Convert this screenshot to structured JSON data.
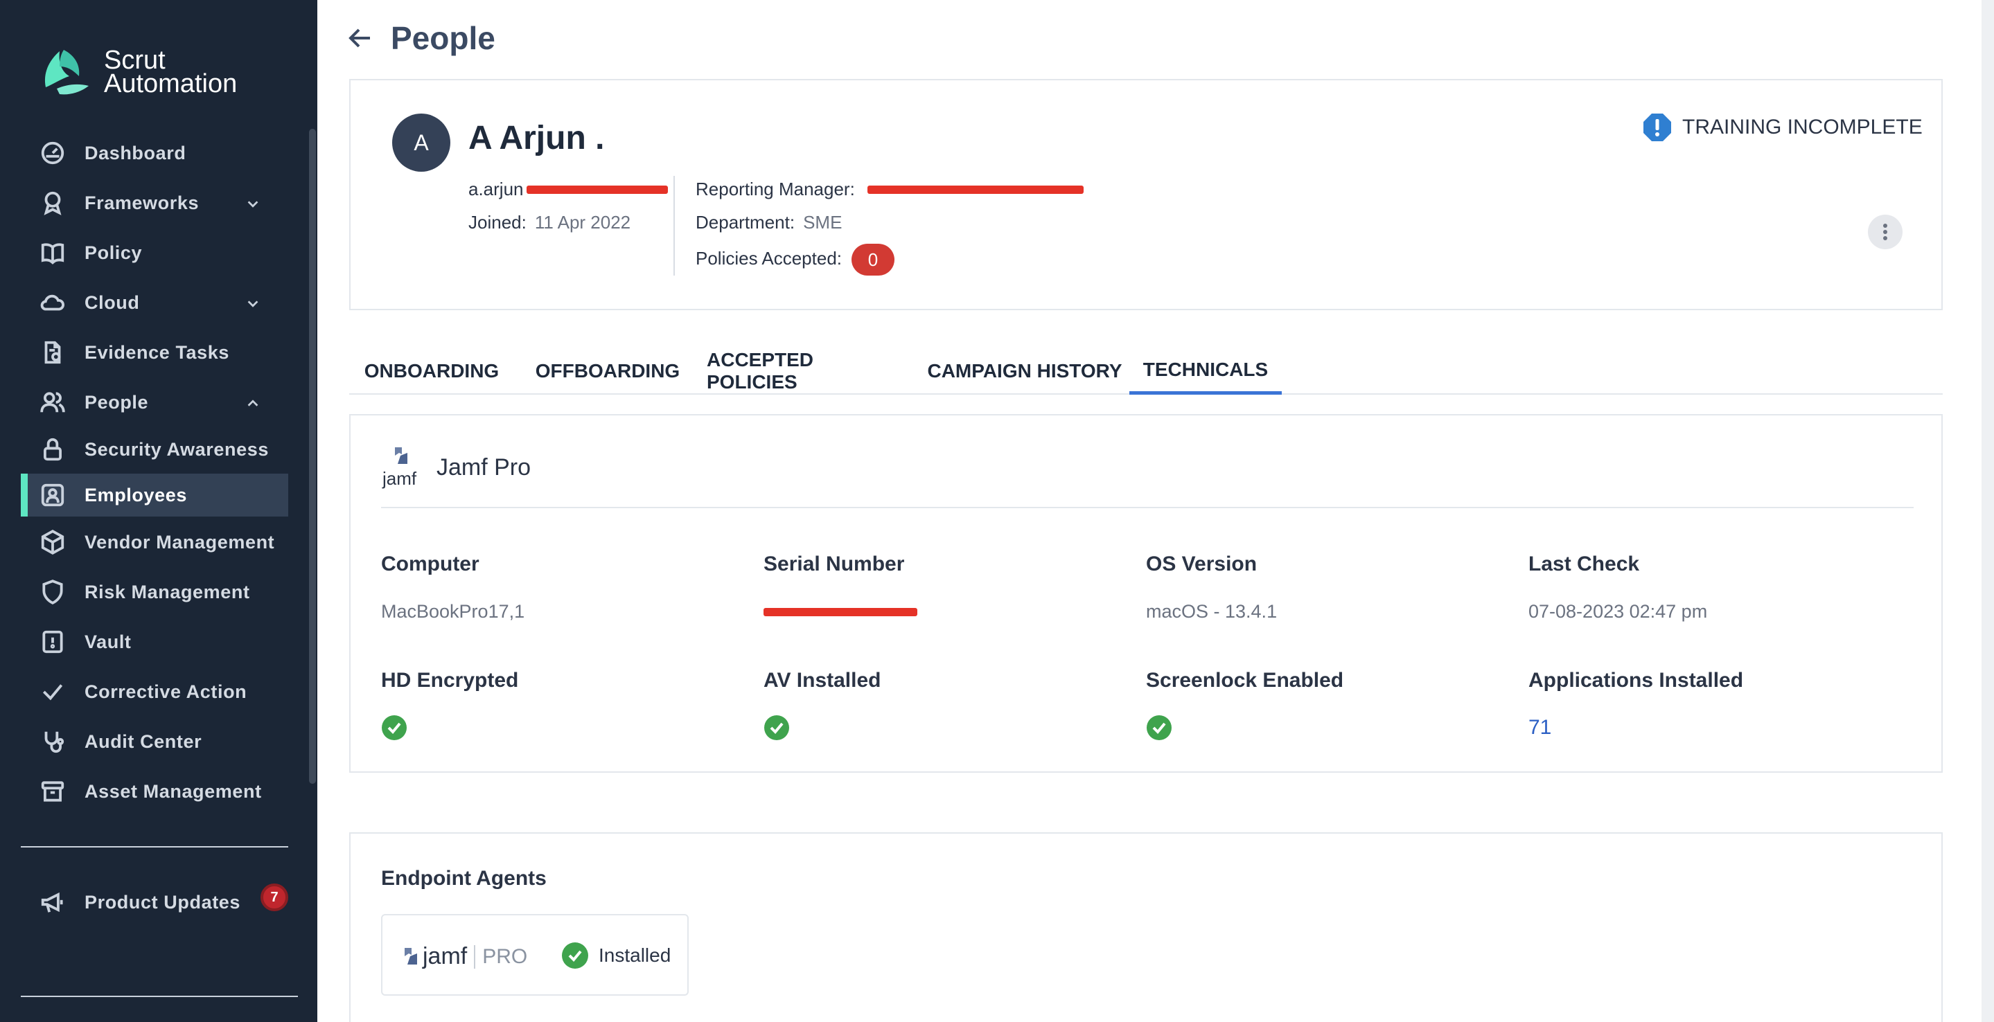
{
  "brand": {
    "line1": "Scrut",
    "line2": "Automation"
  },
  "sidebar": {
    "items": [
      {
        "label": "Dashboard",
        "icon": "dashboard-icon"
      },
      {
        "label": "Frameworks",
        "icon": "frameworks-icon",
        "expandable": true
      },
      {
        "label": "Policy",
        "icon": "book-icon"
      },
      {
        "label": "Cloud",
        "icon": "cloud-icon",
        "expandable": true
      },
      {
        "label": "Evidence Tasks",
        "icon": "evidence-icon"
      },
      {
        "label": "People",
        "icon": "people-icon",
        "expanded": true
      },
      {
        "label": "Security Awareness",
        "icon": "lock-icon"
      },
      {
        "label": "Employees",
        "icon": "employee-icon",
        "active": true
      },
      {
        "label": "Vendor Management",
        "icon": "box-icon"
      },
      {
        "label": "Risk Management",
        "icon": "shield-icon"
      },
      {
        "label": "Vault",
        "icon": "vault-icon"
      },
      {
        "label": "Corrective Action",
        "icon": "check-icon"
      },
      {
        "label": "Audit Center",
        "icon": "stethoscope-icon"
      },
      {
        "label": "Asset Management",
        "icon": "archive-icon"
      }
    ],
    "product_updates": {
      "label": "Product Updates",
      "count": "7"
    }
  },
  "header": {
    "title": "People"
  },
  "profile": {
    "avatar_initial": "A",
    "name": "A Arjun .",
    "email_prefix": "a.arjun",
    "joined_label": "Joined:",
    "joined_value": "11 Apr 2022",
    "reporting_manager_label": "Reporting Manager:",
    "department_label": "Department:",
    "department_value": "SME",
    "policies_accepted_label": "Policies Accepted:",
    "policies_accepted_value": "0",
    "training_status": "TRAINING INCOMPLETE"
  },
  "tabs": [
    {
      "label": "ONBOARDING"
    },
    {
      "label": "OFFBOARDING"
    },
    {
      "label": "ACCEPTED POLICIES"
    },
    {
      "label": "CAMPAIGN HISTORY"
    },
    {
      "label": "TECHNICALS",
      "active": true
    }
  ],
  "technicals": {
    "provider": "Jamf Pro",
    "provider_logo_text": "jamf",
    "computer_label": "Computer",
    "computer_value": "MacBookPro17,1",
    "serial_label": "Serial Number",
    "os_label": "OS Version",
    "os_value": "macOS - 13.4.1",
    "last_check_label": "Last Check",
    "last_check_value": "07-08-2023 02:47 pm",
    "hd_label": "HD Encrypted",
    "av_label": "AV Installed",
    "screenlock_label": "Screenlock Enabled",
    "apps_label": "Applications Installed",
    "apps_value": "71"
  },
  "agents": {
    "title": "Endpoint Agents",
    "logo_text": "jamf",
    "logo_sub": "PRO",
    "status": "Installed"
  },
  "colors": {
    "sidebar_bg": "#1b2636",
    "accent": "#5ee6c2",
    "tab_active": "#3b74d6",
    "success": "#3fa34d",
    "danger": "#d23a33"
  }
}
